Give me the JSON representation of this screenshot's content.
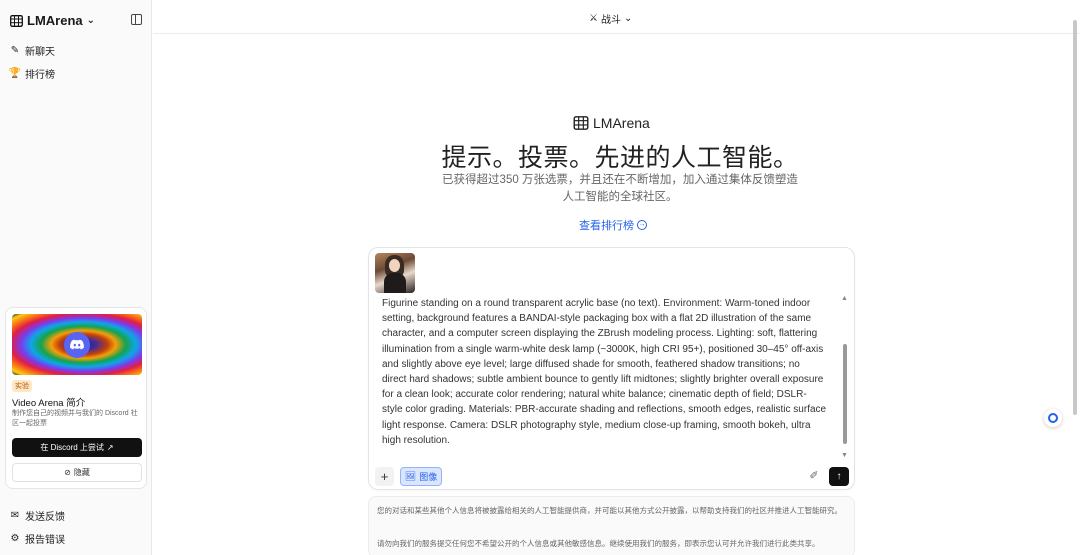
{
  "sidebar": {
    "brand": "LMArena",
    "items": [
      {
        "label": "新聊天",
        "icon": "edit-icon"
      },
      {
        "label": "排行榜",
        "icon": "trophy-icon"
      }
    ],
    "promo": {
      "tag": "实验",
      "title": "Video Arena 简介",
      "desc": "制作您自己的视频并与我们的 Discord 社区一起投票",
      "cta": "在 Discord 上尝试",
      "hide": "隐藏"
    },
    "footer": [
      {
        "label": "发送反馈",
        "icon": "feedback-icon"
      },
      {
        "label": "报告错误",
        "icon": "bug-icon"
      }
    ]
  },
  "topbar": {
    "mode": "战斗"
  },
  "hero": {
    "logo": "LMArena",
    "title": "提示。投票。先进的人工智能。",
    "subtitle": "已获得超过350 万张选票，并且还在不断增加，加入通过集体反馈塑造人工智能的全球社区。",
    "link": "查看排行榜"
  },
  "composer": {
    "prompt": "Figurine standing on a round transparent acrylic base (no text). Environment: Warm-toned indoor setting, background features a BANDAI-style packaging box with a flat 2D illustration of the same character, and a computer screen displaying the ZBrush modeling process. Lighting: soft, flattering illumination from a single warm-white desk lamp (~3000K, high CRI 95+), positioned 30–45° off-axis and slightly above eye level; large diffused shade for smooth, feathered shadow transitions; no direct hard shadows; subtle ambient bounce to gently lift midtones; slightly brighter overall exposure for a clean look; accurate color rendering; natural white balance; cinematic depth of field; DSLR-style color grading. Materials: PBR-accurate shading and reflections, smooth edges, realistic surface light response. Camera: DSLR photography style, medium close-up framing, smooth bokeh, ultra high resolution.",
    "image_label": "图像"
  },
  "notice": {
    "line1": "您的对话和某些其他个人信息将被披露给相关的人工智能提供商，并可能以其他方式公开披露，以帮助支持我们的社区并推进人工智能研究。",
    "line2": "请勿向我们的服务提交任何您不希望公开的个人信息或其他敏感信息。继续使用我们的服务，即表示您认可并允许我们进行此类共享。"
  },
  "colors": {
    "accent": "#2563eb",
    "primary": "#111111",
    "discord": "#5865f2"
  }
}
